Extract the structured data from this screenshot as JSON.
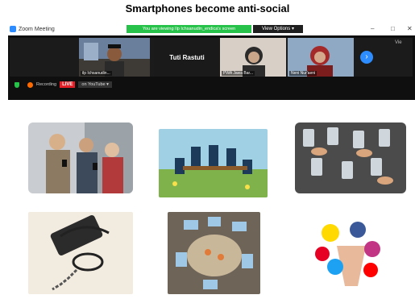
{
  "slide": {
    "title": "Smartphones become anti-social"
  },
  "window": {
    "app_title": "Zoom Meeting"
  },
  "share_banner": {
    "text": "You are viewing Ilp Ichsanudin_endica's screen"
  },
  "view_options": {
    "label": "View Options ▾"
  },
  "window_controls": {
    "minimize": "–",
    "maximize": "□",
    "close": "✕"
  },
  "participants": [
    {
      "name": "ilp Ichsanudin..."
    },
    {
      "name": "Tuti Rastuti"
    },
    {
      "name": "PWA Jawa Bar..."
    },
    {
      "name": "Neni Nur'aeni"
    }
  ],
  "side_view_label": "Vie",
  "recording": {
    "label": "Recording",
    "live": "LIVE",
    "platform": "on YouTube ▾"
  },
  "icons": {
    "zoom": "zoom-logo-icon",
    "next": "chevron-right-icon",
    "shield": "shield-icon",
    "record": "record-dot-icon"
  },
  "colors": {
    "banner": "#27c24a",
    "zoom_blue": "#2d8cff",
    "live_red": "#e41e26"
  }
}
